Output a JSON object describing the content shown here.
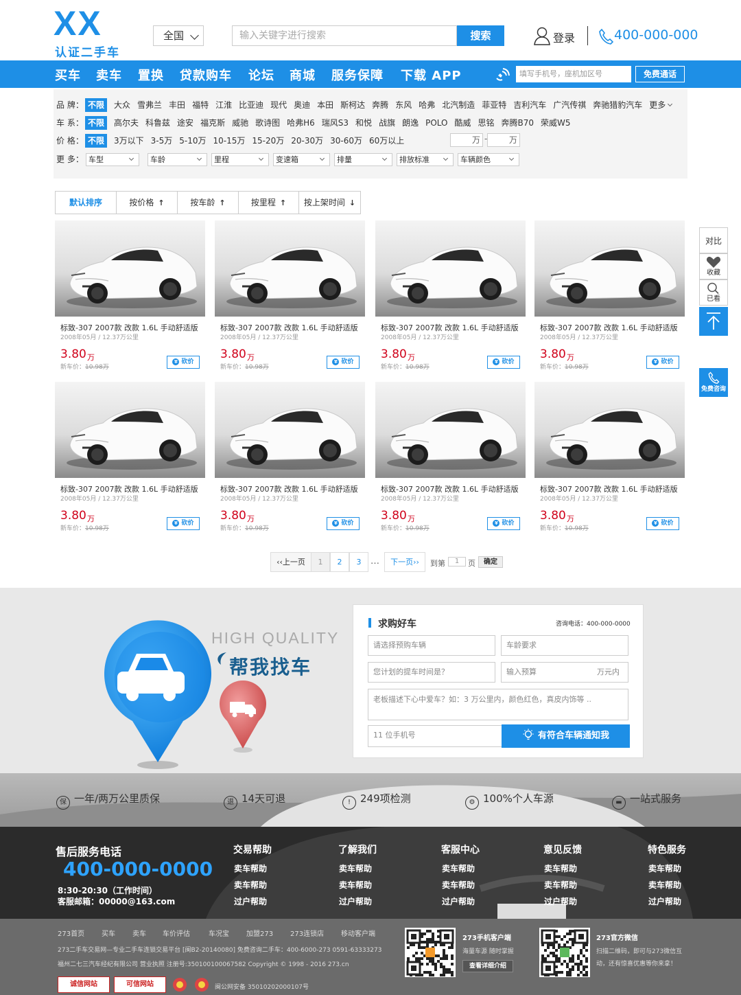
{
  "header": {
    "logo_mark": "XX",
    "logo_text": "认证二手车",
    "region": "全国",
    "search_placeholder": "输入关键字进行搜索",
    "search_button": "搜索",
    "login_label": "登录",
    "hotline": "400-000-000"
  },
  "nav": {
    "items": [
      "买车",
      "卖车",
      "置换",
      "贷款购车",
      "论坛",
      "商城",
      "服务保障",
      "下载 APP"
    ],
    "phone_placeholder": "填写手机号，座机加区号",
    "call_button": "免费通话"
  },
  "filters": {
    "brand_label": "品 牌：",
    "brands": [
      "不限",
      "大众",
      "雪弗兰",
      "丰田",
      "福特",
      "江淮",
      "比亚迪",
      "现代",
      "奥迪",
      "本田",
      "斯柯达",
      "奔腾",
      "东风",
      "哈弗",
      "北汽制造",
      "菲亚特",
      "吉利汽车",
      "广汽传祺",
      "奔驰猎豹汽车"
    ],
    "brand_more": "更多",
    "series_label": "车 系：",
    "series": [
      "不限",
      "高尔夫",
      "科鲁兹",
      "途安",
      "福克斯",
      "威驰",
      "歌诗图",
      "哈弗H6",
      "瑞风S3",
      "和悦",
      "战旗",
      "朗逸",
      "POLO",
      "酷威",
      "思铭",
      "奔腾B70",
      "荣威W5"
    ],
    "price_label": "价 格：",
    "prices": [
      "不限",
      "3万以下",
      "3-5万",
      "5-10万",
      "10-15万",
      "15-20万",
      "20-30万",
      "30-60万",
      "60万以上"
    ],
    "price_unit": "万",
    "price_dash": "-",
    "more_label": "更 多：",
    "selects": [
      "车型",
      "车龄",
      "里程",
      "变速箱",
      "排量",
      "排放标准",
      "车辆颜色"
    ]
  },
  "sort": {
    "options": [
      "默认排序",
      "按价格",
      "按车龄",
      "按里程",
      "按上架时间"
    ],
    "arrows": [
      "",
      "↑",
      "↑",
      "↑",
      "↓"
    ]
  },
  "listing": {
    "cards": [
      {
        "title": "标致-307 2007款 改款 1.6L 手动舒适版",
        "sub": "2008年05月 / 12.37万公里",
        "price": "3.80",
        "unit": "万",
        "new_label": "新车价：",
        "new_price": "10.98万",
        "bargain": "砍价"
      },
      {
        "title": "标致-307 2007款 改款 1.6L 手动舒适版",
        "sub": "2008年05月 / 12.37万公里",
        "price": "3.80",
        "unit": "万",
        "new_label": "新车价：",
        "new_price": "10.98万",
        "bargain": "砍价"
      },
      {
        "title": "标致-307 2007款 改款 1.6L 手动舒适版",
        "sub": "2008年05月 / 12.37万公里",
        "price": "3.80",
        "unit": "万",
        "new_label": "新车价：",
        "new_price": "10.98万",
        "bargain": "砍价"
      },
      {
        "title": "标致-307 2007款 改款 1.6L 手动舒适版",
        "sub": "2008年05月 / 12.37万公里",
        "price": "3.80",
        "unit": "万",
        "new_label": "新车价：",
        "new_price": "10.98万",
        "bargain": "砍价"
      },
      {
        "title": "标致-307 2007款 改款 1.6L 手动舒适版",
        "sub": "2008年05月 / 12.37万公里",
        "price": "3.80",
        "unit": "万",
        "new_label": "新车价：",
        "new_price": "10.98万",
        "bargain": "砍价"
      },
      {
        "title": "标致-307 2007款 改款 1.6L 手动舒适版",
        "sub": "2008年05月 / 12.37万公里",
        "price": "3.80",
        "unit": "万",
        "new_label": "新车价：",
        "new_price": "10.98万",
        "bargain": "砍价"
      },
      {
        "title": "标致-307 2007款 改款 1.6L 手动舒适版",
        "sub": "2008年05月 / 12.37万公里",
        "price": "3.80",
        "unit": "万",
        "new_label": "新车价：",
        "new_price": "10.98万",
        "bargain": "砍价"
      },
      {
        "title": "标致-307 2007款 改款 1.6L 手动舒适版",
        "sub": "2008年05月 / 12.37万公里",
        "price": "3.80",
        "unit": "万",
        "new_label": "新车价：",
        "new_price": "10.98万",
        "bargain": "砍价"
      }
    ]
  },
  "pagination": {
    "prev": "‹‹上一页",
    "pages": [
      "1",
      "2",
      "3"
    ],
    "ellipsis": "…",
    "next": "下一页››",
    "goto_prefix": "到第",
    "goto_value": "1",
    "goto_suffix": "页",
    "confirm": "确定"
  },
  "side": {
    "compare": "对比",
    "favorite": "收藏",
    "viewed": "已看",
    "consult": "免费咨询"
  },
  "find_car": {
    "tagline_en": "HIGH QUALITY",
    "tagline_cn": "帮我找车",
    "form_title": "求购好车",
    "consult_phone": "咨询电话：400-000-0000",
    "car_placeholder": "请选择预购车辆",
    "age_placeholder": "车龄要求",
    "time_placeholder": "您计划的提车时间是？",
    "budget_placeholder": "输入预算",
    "budget_unit": "万元内",
    "desc_placeholder": "老板描述下心中爱车？如：3 万公里内，颜色红色，真皮内饰等 ..",
    "mobile_placeholder": "11 位手机号",
    "submit": "有符合车辆通知我"
  },
  "guarantees": [
    {
      "icon": "保",
      "text": "一年/两万公里质保"
    },
    {
      "icon": "退",
      "text": "14天可退"
    },
    {
      "icon": "!",
      "text": "249项检测"
    },
    {
      "icon": "⚙",
      "text": "100%个人车源"
    },
    {
      "icon": "▬",
      "text": "一站式服务"
    }
  ],
  "footer": {
    "service_title": "售后服务电话",
    "service_phone": "400-000-0000",
    "service_hours": "8:30-20:30（工作时间）",
    "service_email": "客服邮箱：00000@163.com",
    "columns": [
      {
        "title": "交易帮助",
        "links": [
          "卖车帮助",
          "卖车帮助",
          "过户帮助"
        ]
      },
      {
        "title": "了解我们",
        "links": [
          "卖车帮助",
          "卖车帮助",
          "过户帮助"
        ]
      },
      {
        "title": "客服中心",
        "links": [
          "卖车帮助",
          "卖车帮助",
          "过户帮助"
        ]
      },
      {
        "title": "意见反馈",
        "links": [
          "卖车帮助",
          "卖车帮助",
          "过户帮助"
        ]
      },
      {
        "title": "特色服务",
        "links": [
          "卖车帮助",
          "卖车帮助",
          "过户帮助"
        ]
      }
    ]
  },
  "bottom": {
    "links": [
      "273首页",
      "买车",
      "卖车",
      "车价评估",
      "车况宝",
      "加盟273",
      "273连锁店",
      "移动客户端"
    ],
    "line1": "273二手车交易网—专业二手车连锁交易平台 [闽B2-20140080]  免费咨询二手车：400-6000-273 0591-63333273",
    "line2": "福州二七三汽车经纪有限公司 营业执照 注册号:350100100067582  Copyright © 1998 - 2016 273.cn",
    "police": "闽公网安备 35010202000107号",
    "badge1": "诚信网站",
    "badge2": "可信网站",
    "app_title": "273手机客户端",
    "app_desc": "海量车源 随时掌握",
    "app_button": "查看详细介绍",
    "wechat_title": "273官方微信",
    "wechat_desc1": "扫描二维码，即可与273微信互",
    "wechat_desc2": "动，还有惊喜优惠等你来拿！"
  },
  "colors": {
    "brand": "#1e8fe6",
    "price": "#d0021b",
    "footer_dark": "#2b2b2b"
  }
}
